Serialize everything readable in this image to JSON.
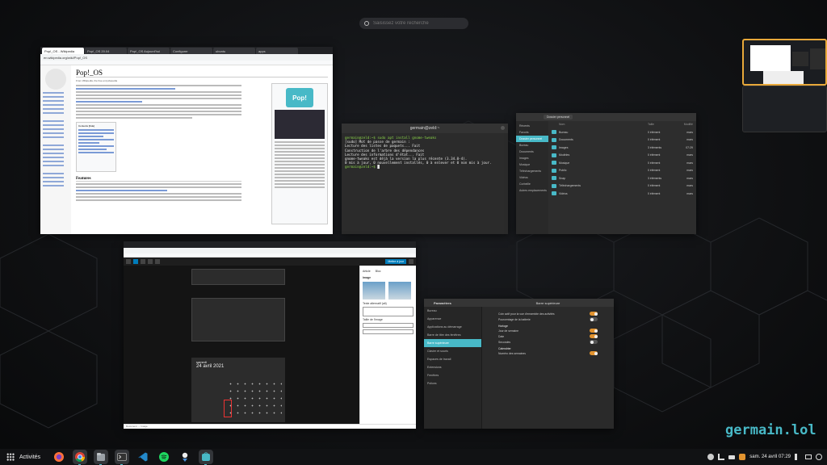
{
  "search": {
    "placeholder": "Saisissez votre recherche"
  },
  "chrome": {
    "tabs": [
      "Pop!_OS - Wikipedia",
      "Pop!_OS 20.04",
      "Pop!_OS Aujourd'hui",
      "Configurer",
      "ubuntu",
      "apps",
      "pop_os",
      "germain.lol"
    ],
    "url": "en.wikipedia.org/wiki/Pop!_OS",
    "page_title": "Pop!_OS",
    "subtitle": "From Wikipedia, the free encyclopedia",
    "infobox_logo": "Pop!",
    "contents_title": "Contents [hide]",
    "section_features": "Features"
  },
  "terminal": {
    "title": "germain@zeld:~",
    "lines": [
      {
        "kind": "prompt",
        "text": "germain@zeld:~$ sudo apt install gnome-tweaks"
      },
      {
        "kind": "out",
        "text": "[sudo] Mot de passe de germain :"
      },
      {
        "kind": "out",
        "text": "Lecture des listes de paquets... Fait"
      },
      {
        "kind": "out",
        "text": "Construction de l'arbre des dépendances"
      },
      {
        "kind": "out",
        "text": "Lecture des informations d'état... Fait"
      },
      {
        "kind": "out",
        "text": "gnome-tweaks est déjà la version la plus récente (3.34.0-4)."
      },
      {
        "kind": "out",
        "text": "0 mis à jour, 0 nouvellement installés, 0 à enlever et 0 non mis à jour."
      },
      {
        "kind": "prompt",
        "text": "germain@zeld:~$ "
      }
    ]
  },
  "files": {
    "crumb": "Dossier personnel",
    "headers": {
      "name": "Nom",
      "size": "Taille",
      "mod": "Modifié"
    },
    "sidebar": [
      "Récents",
      "Favoris",
      "Dossier personnel",
      "Bureau",
      "Documents",
      "Images",
      "Musique",
      "Téléchargements",
      "Vidéos",
      "Corbeille",
      "Autres emplacements"
    ],
    "rows": [
      {
        "name": "Bureau",
        "size": "0 élément",
        "date": "mars"
      },
      {
        "name": "Documents",
        "size": "0 élément",
        "date": "mars"
      },
      {
        "name": "Images",
        "size": "3 éléments",
        "date": "07:29"
      },
      {
        "name": "Modèles",
        "size": "0 élément",
        "date": "mars"
      },
      {
        "name": "Musique",
        "size": "0 élément",
        "date": "mars"
      },
      {
        "name": "Public",
        "size": "0 élément",
        "date": "mars"
      },
      {
        "name": "Snap",
        "size": "3 éléments",
        "date": "mars"
      },
      {
        "name": "Téléchargements",
        "size": "0 élément",
        "date": "mars"
      },
      {
        "name": "Vidéos",
        "size": "0 élément",
        "date": "mars"
      }
    ]
  },
  "wordpress": {
    "publish_label": "Mettre à jour",
    "panel_tabs": [
      "Article",
      "Bloc"
    ],
    "panel_title": "Image",
    "alt_label": "Texte alternatif (alt)",
    "size_label": "Taille de l'image",
    "cal_day": "samedi",
    "cal_date": "24 avril 2021",
    "breadcrumb": "Document → Image"
  },
  "settings": {
    "title_left": "Paramètres",
    "title_right": "Barre supérieure",
    "sidebar": [
      "Bureau",
      "Apparence",
      "Applications au démarrage",
      "Barre de titre des fenêtres",
      "Barre supérieure",
      "Clavier et souris",
      "Espaces de travail",
      "Extensions",
      "Fenêtres",
      "Polices"
    ],
    "selected": "Barre supérieure",
    "options": [
      {
        "label": "Coin actif pour la vue d'ensemble des activités",
        "on": true
      },
      {
        "label": "Pourcentage de la batterie",
        "on": false
      }
    ],
    "section_clock": "Horloge",
    "clock_opts": [
      {
        "label": "Jour de semaine",
        "on": true
      },
      {
        "label": "Date",
        "on": true
      },
      {
        "label": "Secondes",
        "on": false
      }
    ],
    "section_cal": "Calendrier",
    "cal_opts": [
      {
        "label": "Numéro des semaines",
        "on": true
      }
    ]
  },
  "watermark": "germain.lol",
  "dock": {
    "activities": "Activités",
    "clock": "sam. 24 avril  07:29",
    "apps": [
      "pop-shop-icon",
      "firefox-icon",
      "chrome-icon",
      "files-icon",
      "terminal-icon",
      "vscode-icon",
      "spotify-icon",
      "pop-shop-2-icon",
      "shutter-icon"
    ]
  },
  "colors": {
    "accent": "#48b9c7",
    "workspace_active": "#e8a83a",
    "toggle_on": "#e2932f"
  }
}
